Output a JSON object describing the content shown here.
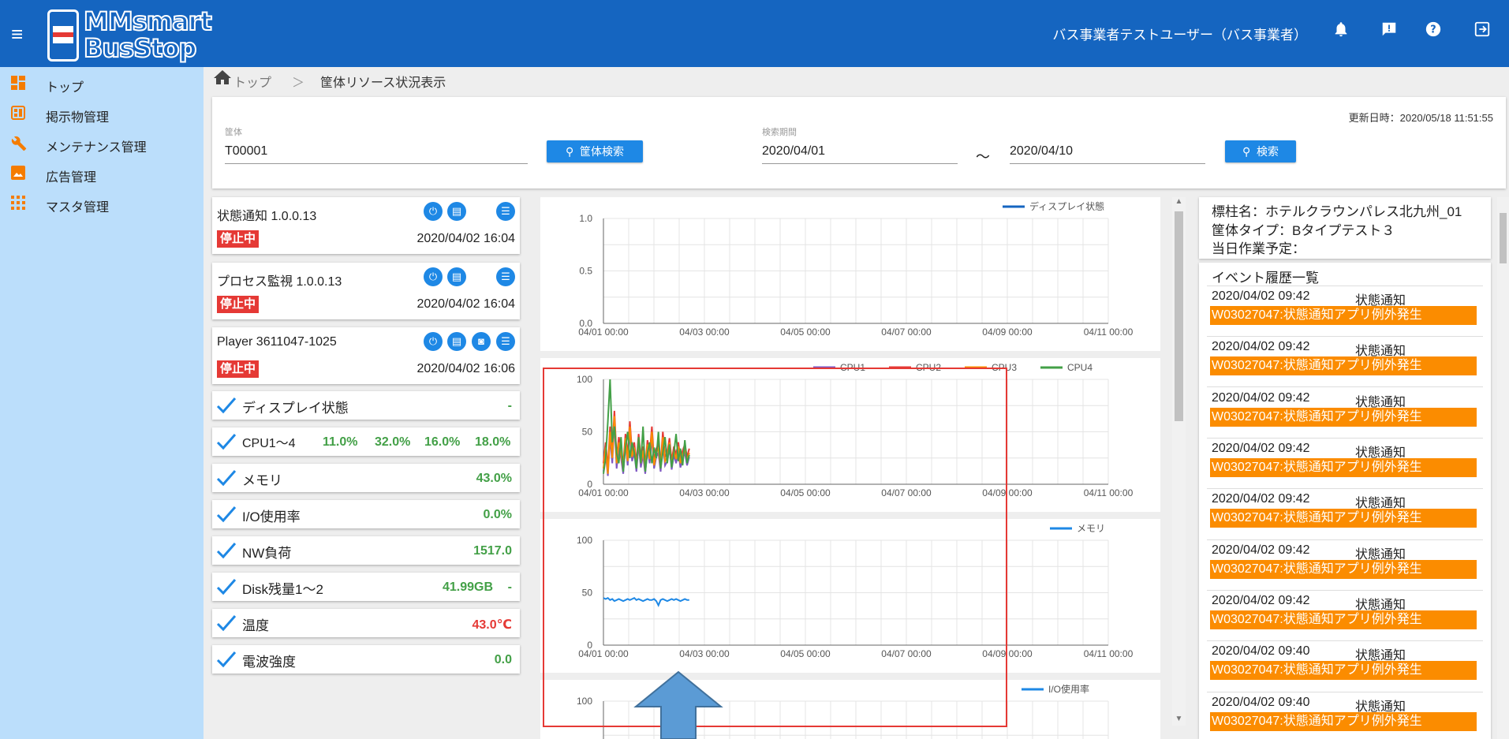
{
  "header": {
    "logo_line1": "MMsmart",
    "logo_line2": "BusStop",
    "user": "バス事業者テストユーザー（バス事業者）",
    "icons": [
      "menu-icon",
      "bell-icon",
      "message-icon",
      "help-icon",
      "logout-icon"
    ]
  },
  "sidebar": {
    "items": [
      {
        "label": "トップ",
        "icon": "dashboard-icon"
      },
      {
        "label": "掲示物管理",
        "icon": "board-icon"
      },
      {
        "label": "メンテナンス管理",
        "icon": "wrench-icon"
      },
      {
        "label": "広告管理",
        "icon": "image-icon"
      },
      {
        "label": "マスタ管理",
        "icon": "grid-icon"
      }
    ]
  },
  "breadcrumb": {
    "home": "トップ",
    "separator": "＞",
    "current": "筐体リソース状況表示"
  },
  "search": {
    "updated": "更新日時：2020/05/18 11:51:55",
    "device_label": "筐体",
    "device_value": "T00001",
    "device_button": "筐体検索",
    "period_label": "検索期間",
    "date_from": "2020/04/01",
    "tilde": "～",
    "date_to": "2020/04/10",
    "search_button": "検索"
  },
  "apps": [
    {
      "title": "状態通知 1.0.0.13",
      "status": "停止中",
      "datetime": "2020/04/02 16:04"
    },
    {
      "title": "プロセス監視 1.0.0.13",
      "status": "停止中",
      "datetime": "2020/04/02 16:04"
    },
    {
      "title": "Player 3611047-1025",
      "status": "停止中",
      "datetime": "2020/04/02 16:06"
    }
  ],
  "metrics": {
    "display": {
      "name": "ディスプレイ状態",
      "value": "-"
    },
    "cpu": {
      "name": "CPU1～4",
      "v1": "11.0%",
      "v2": "32.0%",
      "v3": "16.0%",
      "v4": "18.0%"
    },
    "memory": {
      "name": "メモリ",
      "value": "43.0%"
    },
    "io": {
      "name": "I/O使用率",
      "value": "0.0%"
    },
    "nw": {
      "name": "NW負荷",
      "value": "1517.0"
    },
    "disk": {
      "name": "Disk残量1～2",
      "value": "41.99GB",
      "value2": "-"
    },
    "temp": {
      "name": "温度",
      "value": "43.0℃"
    },
    "radio": {
      "name": "電波強度",
      "value": "0.0"
    }
  },
  "colors": {
    "ok": "#43a047",
    "alert": "#e53935",
    "primary": "#1e88e5",
    "event": "#fb8c00",
    "highlight": "#e53935",
    "arrow": "#5b9bd5"
  },
  "chart_data": [
    {
      "type": "line",
      "x_ticks": [
        "04/01 00:00",
        "04/03 00:00",
        "04/05 00:00",
        "04/07 00:00",
        "04/09 00:00",
        "04/11 00:00"
      ],
      "y_ticks": [
        "1.0",
        "0.5",
        "0.0"
      ],
      "ylim": [
        0,
        1
      ],
      "series": [
        {
          "name": "ディスプレイ状態",
          "color": "#1565c0",
          "values": []
        }
      ]
    },
    {
      "type": "line",
      "x_ticks": [
        "04/01 00:00",
        "04/03 00:00",
        "04/05 00:00",
        "04/07 00:00",
        "04/09 00:00",
        "04/11 00:00"
      ],
      "y_ticks": [
        "100",
        "50",
        "0"
      ],
      "ylim": [
        0,
        100
      ],
      "x_range_days": [
        0,
        1.7
      ],
      "series": [
        {
          "name": "CPU1",
          "color": "#7e57c2",
          "values": [
            12,
            30,
            8,
            45,
            20,
            60,
            15,
            35,
            25,
            10,
            40,
            18,
            50,
            22,
            30,
            12,
            38,
            16,
            28,
            10,
            34,
            20,
            45,
            15,
            26,
            30,
            12,
            40,
            18,
            22,
            35,
            14,
            28,
            20,
            32,
            16,
            24,
            30,
            18,
            26
          ]
        },
        {
          "name": "CPU2",
          "color": "#e53935",
          "values": [
            20,
            40,
            15,
            55,
            30,
            70,
            25,
            45,
            35,
            18,
            48,
            28,
            60,
            30,
            40,
            20,
            48,
            24,
            36,
            18,
            42,
            28,
            55,
            22,
            34,
            38,
            20,
            50,
            26,
            30,
            44,
            22,
            36,
            28,
            40,
            24,
            32,
            38,
            26,
            34
          ]
        },
        {
          "name": "CPU3",
          "color": "#fb8c00",
          "values": [
            15,
            35,
            10,
            50,
            25,
            65,
            20,
            40,
            30,
            14,
            44,
            22,
            55,
            26,
            35,
            16,
            42,
            20,
            32,
            14,
            38,
            24,
            50,
            18,
            30,
            34,
            16,
            45,
            22,
            26,
            40,
            18,
            32,
            24,
            36,
            20,
            28,
            34,
            22,
            30
          ]
        },
        {
          "name": "CPU4",
          "color": "#43a047",
          "values": [
            10,
            25,
            60,
            100,
            40,
            55,
            30,
            20,
            45,
            12,
            35,
            50,
            25,
            40,
            30,
            15,
            45,
            20,
            55,
            12,
            30,
            40,
            20,
            35,
            25,
            50,
            15,
            30,
            45,
            20,
            38,
            16,
            30,
            48,
            22,
            34,
            18,
            42,
            20,
            28
          ]
        }
      ]
    },
    {
      "type": "line",
      "x_ticks": [
        "04/01 00:00",
        "04/03 00:00",
        "04/05 00:00",
        "04/07 00:00",
        "04/09 00:00",
        "04/11 00:00"
      ],
      "y_ticks": [
        "100",
        "50",
        "0"
      ],
      "ylim": [
        0,
        100
      ],
      "x_range_days": [
        0,
        1.7
      ],
      "series": [
        {
          "name": "メモリ",
          "color": "#1e88e5",
          "values": [
            45,
            44,
            45,
            43,
            44,
            42,
            43,
            44,
            43,
            42,
            43,
            44,
            43,
            44,
            45,
            43,
            44,
            43,
            42,
            43,
            44,
            43,
            43,
            44,
            42,
            38,
            43,
            44,
            43,
            42,
            43,
            44,
            43,
            44,
            43,
            42,
            43,
            44,
            43,
            43
          ]
        }
      ]
    },
    {
      "type": "line",
      "y_ticks": [
        "100"
      ],
      "series": [
        {
          "name": "I/O使用率",
          "color": "#1e88e5",
          "values": []
        }
      ]
    }
  ],
  "right": {
    "info_line1": "標柱名：ホテルクラウンパレス北九州_01",
    "info_line2": "筐体タイプ：Bタイプテスト３",
    "info_line3": "当日作業予定：",
    "event_title": "イベント履歴一覧",
    "events": [
      {
        "date": "2020/04/02 09:42",
        "type": "状態通知",
        "message": "W03027047:状態通知アプリ例外発生"
      },
      {
        "date": "2020/04/02 09:42",
        "type": "状態通知",
        "message": "W03027047:状態通知アプリ例外発生"
      },
      {
        "date": "2020/04/02 09:42",
        "type": "状態通知",
        "message": "W03027047:状態通知アプリ例外発生"
      },
      {
        "date": "2020/04/02 09:42",
        "type": "状態通知",
        "message": "W03027047:状態通知アプリ例外発生"
      },
      {
        "date": "2020/04/02 09:42",
        "type": "状態通知",
        "message": "W03027047:状態通知アプリ例外発生"
      },
      {
        "date": "2020/04/02 09:42",
        "type": "状態通知",
        "message": "W03027047:状態通知アプリ例外発生"
      },
      {
        "date": "2020/04/02 09:42",
        "type": "状態通知",
        "message": "W03027047:状態通知アプリ例外発生"
      },
      {
        "date": "2020/04/02 09:40",
        "type": "状態通知",
        "message": "W03027047:状態通知アプリ例外発生"
      },
      {
        "date": "2020/04/02 09:40",
        "type": "状態通知",
        "message": "W03027047:状態通知アプリ例外発生"
      }
    ]
  }
}
